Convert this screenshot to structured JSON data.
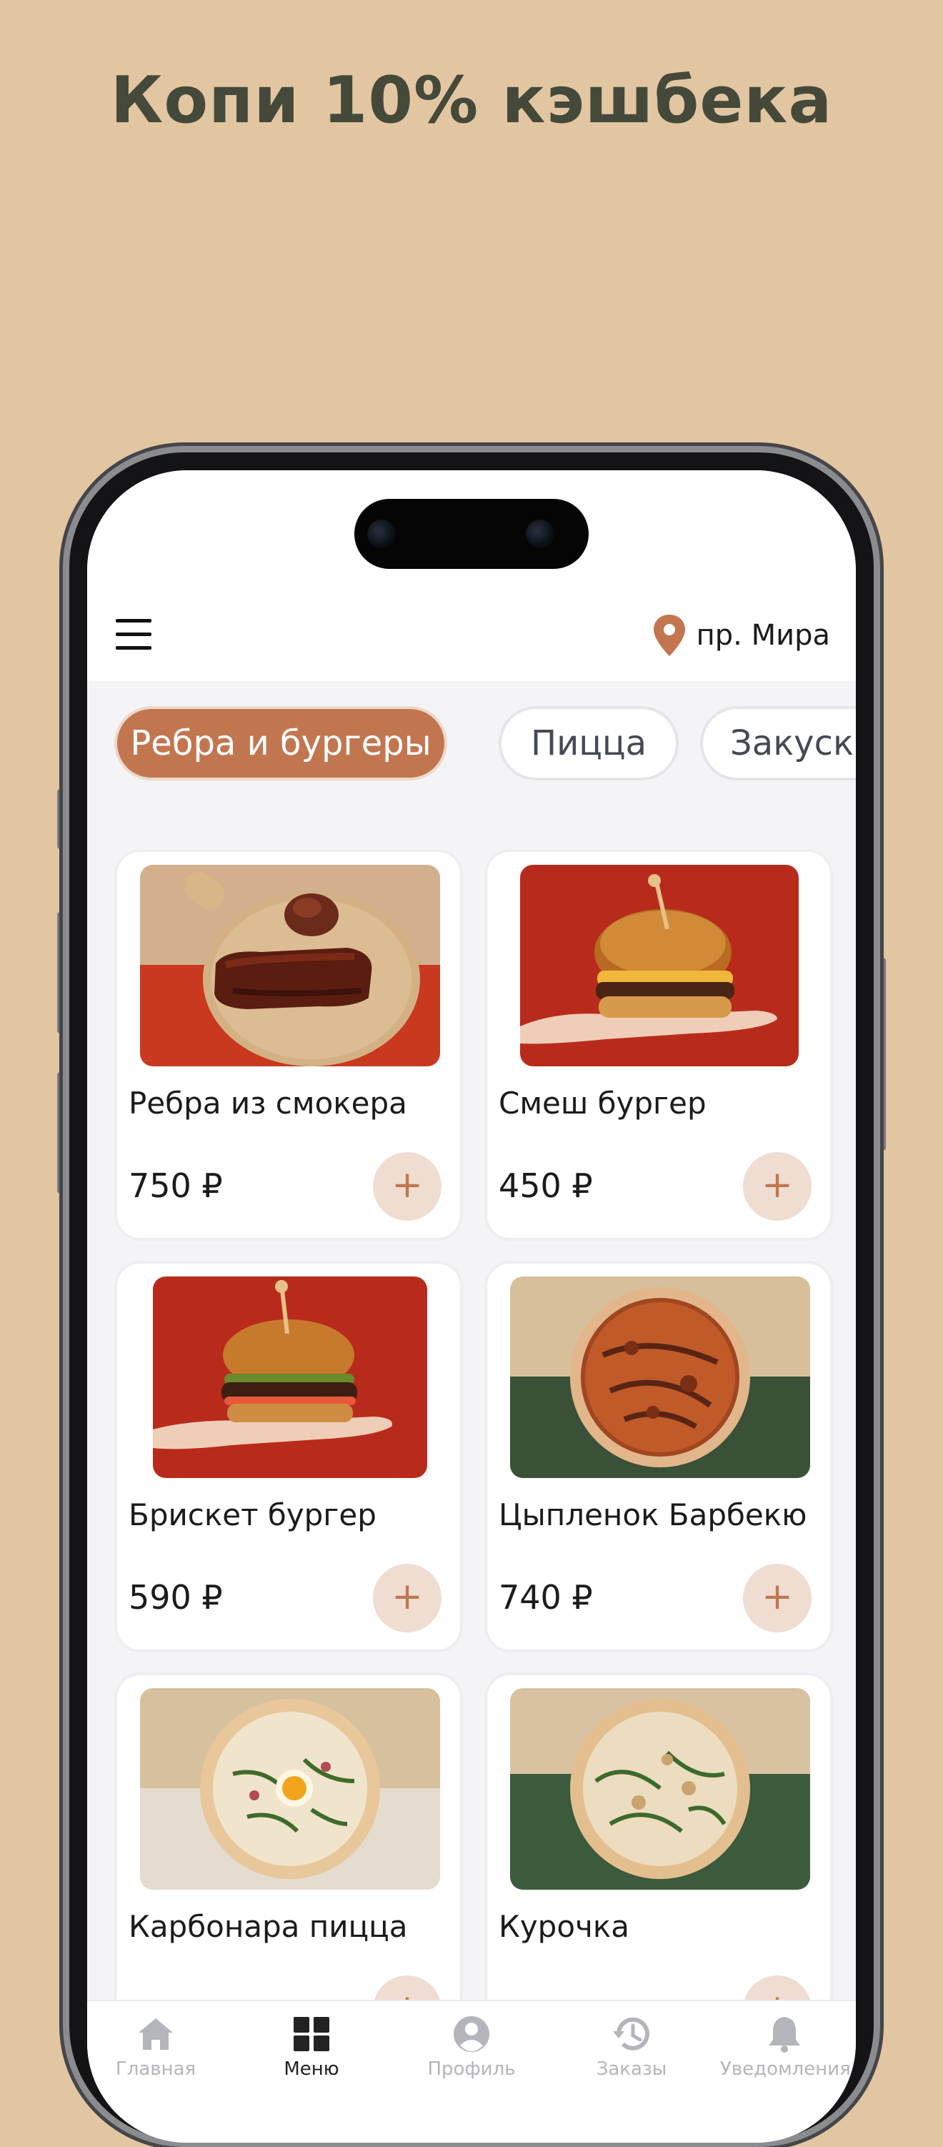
{
  "headline": "Копи 10% кэшбека",
  "header": {
    "menu_icon": "hamburger-icon",
    "location_icon": "map-pin-icon",
    "location": "пр. Мира"
  },
  "categories": [
    {
      "label": "Ребра и бургеры",
      "active": true
    },
    {
      "label": "Пицца",
      "active": false
    },
    {
      "label": "Закуски",
      "active": false
    }
  ],
  "products": [
    {
      "name": "Ребра из смокера",
      "price": "750 ₽",
      "image": "smoked-ribs-photo"
    },
    {
      "name": "Смеш бургер",
      "price": "450 ₽",
      "image": "smash-burger-photo"
    },
    {
      "name": "Брискет бургер",
      "price": "590 ₽",
      "image": "brisket-burger-photo"
    },
    {
      "name": "Цыпленок Барбекю",
      "price": "740 ₽",
      "image": "bbq-chicken-pizza-photo"
    },
    {
      "name": "Карбонара пицца",
      "price": "",
      "image": "carbonara-pizza-photo"
    },
    {
      "name": "Курочка",
      "price": "",
      "image": "chicken-pizza-photo"
    }
  ],
  "add_button": "+",
  "tabs": [
    {
      "label": "Главная",
      "icon": "home-icon",
      "active": false
    },
    {
      "label": "Меню",
      "icon": "grid-icon",
      "active": true
    },
    {
      "label": "Профиль",
      "icon": "user-icon",
      "active": false
    },
    {
      "label": "Заказы",
      "icon": "history-icon",
      "active": false
    },
    {
      "label": "Уведомления",
      "icon": "bell-icon",
      "active": false
    }
  ],
  "colors": {
    "background": "#e2c6a2",
    "accent": "#c27650",
    "headline": "#45493a"
  }
}
